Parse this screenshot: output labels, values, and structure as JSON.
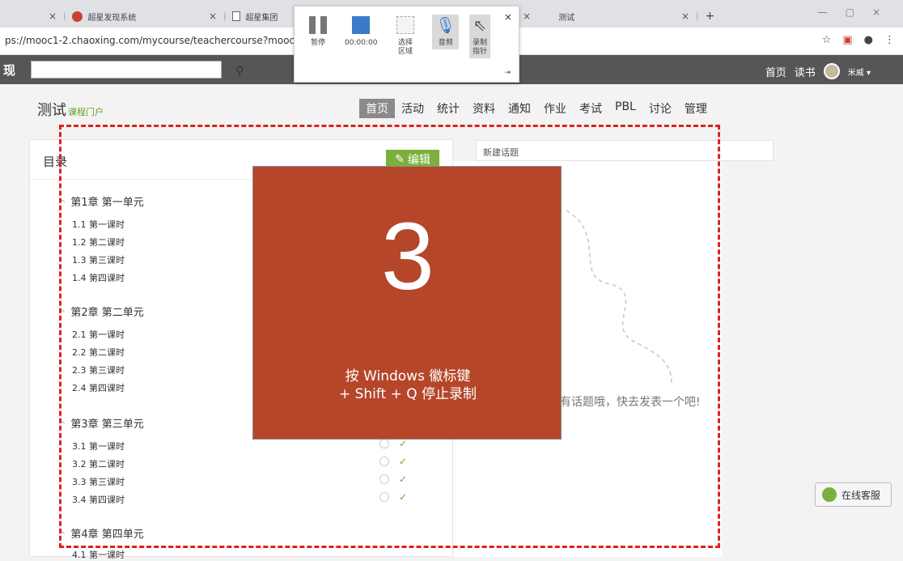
{
  "browser": {
    "tabs": [
      {
        "label": "超星发现系统",
        "icon": "red-circle-icon"
      },
      {
        "label": "超星集团",
        "icon": "page-icon"
      },
      {
        "label": "测试",
        "icon": ""
      }
    ],
    "new_tab": "+",
    "url": "ps://mooc1-2.chaoxing.com/mycourse/teachercourse?moocId=2"
  },
  "recorder": {
    "pause_label": "暂停",
    "timer": "00:00:00",
    "select_label_1": "选择",
    "select_label_2": "区域",
    "audio_label": "音频",
    "pointer_label_1": "录制",
    "pointer_label_2": "指针"
  },
  "site": {
    "logo_fragment": "现",
    "header_links": [
      "首页",
      "读书"
    ],
    "user_name": "米威 ▾"
  },
  "course": {
    "title": "测试",
    "subtitle": "课程门户",
    "tabs": [
      "首页",
      "活动",
      "统计",
      "资料",
      "通知",
      "作业",
      "考试",
      "PBL",
      "讨论",
      "管理"
    ],
    "active_tab": "首页"
  },
  "toc": {
    "title": "目录",
    "edit_label": "编辑",
    "chapters": [
      {
        "title": "第1章 第一单元",
        "lessons": [
          "1.1  第一课时",
          "1.2  第二课时",
          "1.3  第三课时",
          "1.4  第四课时"
        ]
      },
      {
        "title": "第2章 第二单元",
        "lessons": [
          "2.1  第一课时",
          "2.2  第二课时",
          "2.3  第三课时",
          "2.4  第四课时"
        ]
      },
      {
        "title": "第3章 第三单元",
        "lessons": [
          "3.1  第一课时",
          "3.2  第二课时",
          "3.3  第三课时",
          "3.4  第四课时"
        ]
      },
      {
        "title": "第4章 第四单元",
        "lessons": [
          "4.1  第一课时"
        ]
      }
    ]
  },
  "topics": {
    "new_placeholder": "新建话题",
    "empty_message": "有话题哦，快去发表一个吧!"
  },
  "countdown": {
    "number": "3",
    "hint_line1": "按 Windows 徽标键",
    "hint_line2": "+ Shift + Q 停止录制"
  },
  "support": {
    "label": "在线客服"
  },
  "colors": {
    "countdown_bg": "#b5462a",
    "accent_green": "#7ab13c",
    "record_area": "#e02020"
  }
}
